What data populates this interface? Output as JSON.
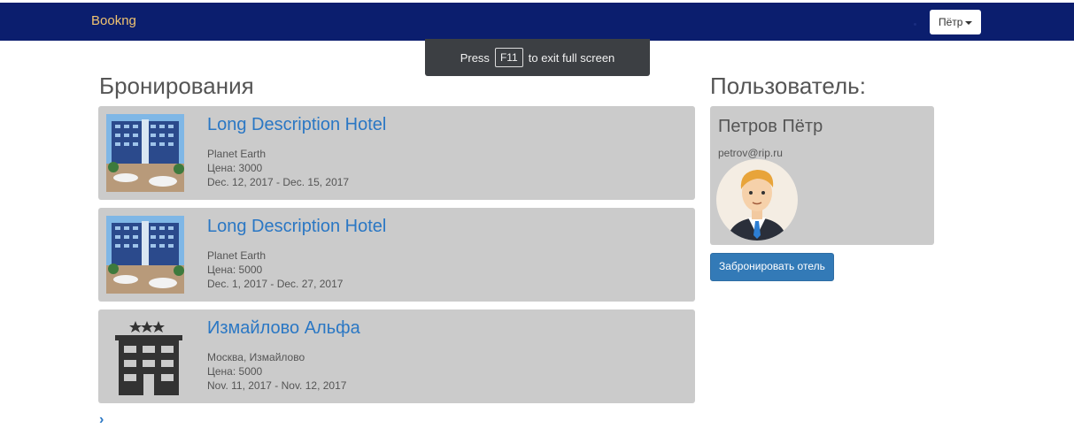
{
  "navbar": {
    "brand": "Bookng",
    "user_menu": "Пётр"
  },
  "fullscreen_toast": {
    "before": "Press",
    "key": "F11",
    "after": "to exit full screen"
  },
  "bookings": {
    "heading": "Бронирования",
    "items": [
      {
        "title": "Long Description Hotel",
        "location": "Planet Earth",
        "price": "Цена: 3000",
        "dates": "Dec. 12, 2017 - Dec. 15, 2017",
        "image": "hotel-photo"
      },
      {
        "title": "Long Description Hotel",
        "location": "Planet Earth",
        "price": "Цена: 5000",
        "dates": "Dec. 1, 2017 - Dec. 27, 2017",
        "image": "hotel-photo"
      },
      {
        "title": "Измайлово Альфа",
        "location": "Москва, Измайлово",
        "price": "Цена: 5000",
        "dates": "Nov. 11, 2017 - Nov. 12, 2017",
        "image": "hotel-building-icon"
      }
    ],
    "pager_icon": "chevron-right-icon"
  },
  "user": {
    "heading": "Пользователь:",
    "name": "Петров Пётр",
    "email": "petrov@rip.ru",
    "book_button": "Забронировать отель"
  }
}
